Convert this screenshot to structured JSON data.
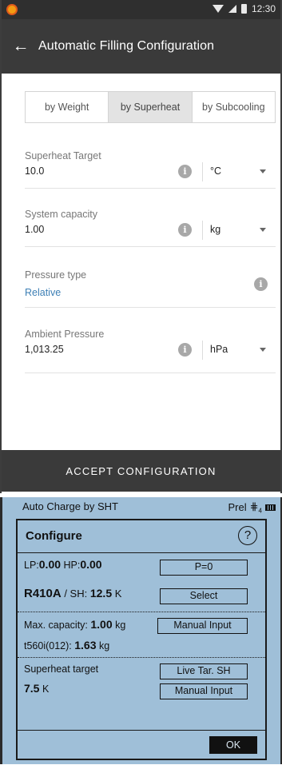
{
  "status_bar": {
    "time": "12:30"
  },
  "app_bar": {
    "title": "Automatic Filling Configuration"
  },
  "tabs": [
    {
      "label": "by Weight",
      "active": false
    },
    {
      "label": "by Superheat",
      "active": true
    },
    {
      "label": "by Subcooling",
      "active": false
    }
  ],
  "fields": {
    "superheat_target": {
      "label": "Superheat Target",
      "value": "10.0",
      "unit": "°C"
    },
    "system_capacity": {
      "label": "System capacity",
      "value": "1.00",
      "unit": "kg"
    },
    "pressure_type": {
      "label": "Pressure type",
      "value": "Relative"
    },
    "ambient_pressure": {
      "label": "Ambient Pressure",
      "value": "1,013.25",
      "unit": "hPa"
    }
  },
  "accept_button": "ACCEPT CONFIGURATION",
  "device": {
    "header_left": "Auto Charge by SHT",
    "header_right": "Prel",
    "bt_icon": "bluetooth-icon",
    "battery_icon": "battery-icon",
    "dialog_title": "Configure",
    "help_icon": "?",
    "lp_label": "LP:",
    "lp_value": "0.00",
    "hp_label": "HP:",
    "hp_value": "0.00",
    "p0_button": "P=0",
    "refrigerant": "R410A",
    "sh_label": "/ SH:",
    "sh_value": "12.5",
    "sh_unit": "K",
    "select_button": "Select",
    "max_capacity_label": "Max. capacity:",
    "max_capacity_value": "1.00",
    "max_capacity_unit": "kg",
    "manual_input_1": "Manual Input",
    "scale_label": "t560i(012):",
    "scale_value": "1.63",
    "scale_unit": "kg",
    "superheat_target_label": "Superheat target",
    "superheat_target_value": "7.5",
    "superheat_target_unit": "K",
    "live_tar_button": "Live Tar. SH",
    "manual_input_2": "Manual Input",
    "ok_button": "OK"
  }
}
